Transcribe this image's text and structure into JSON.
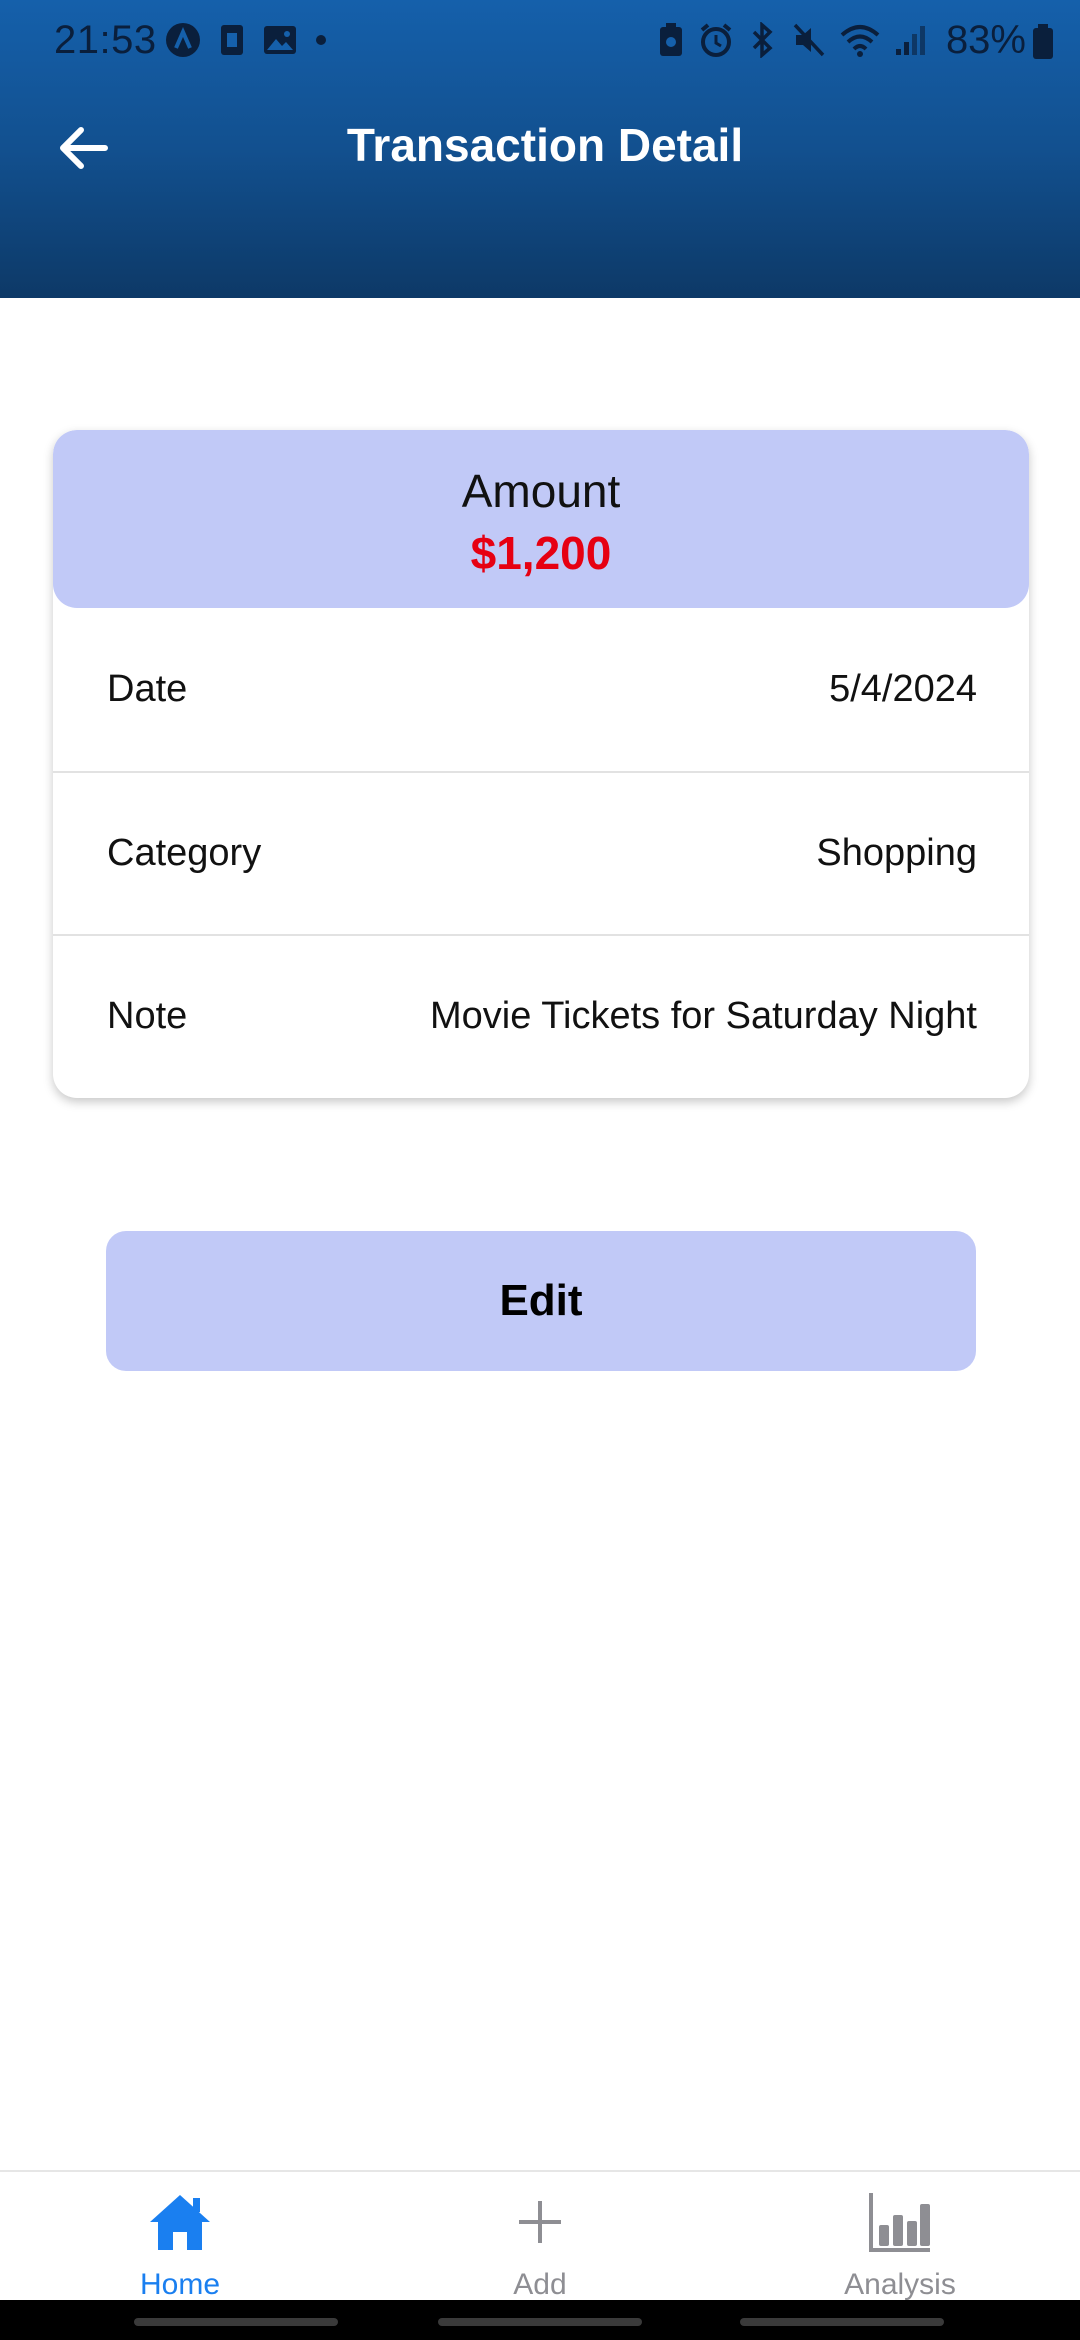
{
  "status_bar": {
    "time": "21:53",
    "battery": "83%"
  },
  "header": {
    "title": "Transaction Detail"
  },
  "amount": {
    "label": "Amount",
    "value": "$1,200"
  },
  "details": [
    {
      "label": "Date",
      "value": "5/4/2024"
    },
    {
      "label": "Category",
      "value": "Shopping"
    },
    {
      "label": "Note",
      "value": "Movie Tickets for Saturday Night"
    }
  ],
  "actions": {
    "edit_label": "Edit"
  },
  "bottom_nav": {
    "items": [
      {
        "label": "Home",
        "icon": "home-icon",
        "active": true
      },
      {
        "label": "Add",
        "icon": "plus-icon",
        "active": false
      },
      {
        "label": "Analysis",
        "icon": "bar-chart-icon",
        "active": false
      }
    ]
  },
  "colors": {
    "header_top": "#1560ab",
    "header_bottom": "#0d3967",
    "accent_surface": "#c1c9f7",
    "amount_negative": "#e60012",
    "nav_active": "#1a7ff0",
    "nav_inactive": "#8e8e93"
  }
}
